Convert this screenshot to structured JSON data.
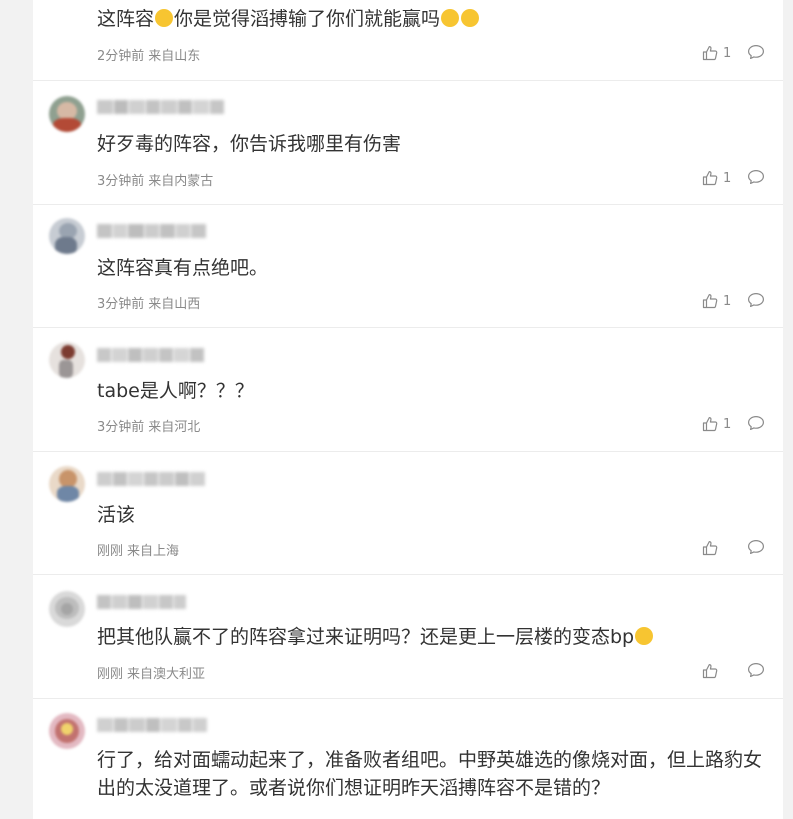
{
  "comments": [
    {
      "text": "这阵容",
      "text_after": "你是觉得滔搏输了你们就能赢吗",
      "time": "2分钟前",
      "location": "来自山东",
      "likes": "1"
    },
    {
      "text": "好歹毒的阵容，你告诉我哪里有伤害",
      "time": "3分钟前",
      "location": "来自内蒙古",
      "likes": "1"
    },
    {
      "text": "这阵容真有点绝吧。",
      "time": "3分钟前",
      "location": "来自山西",
      "likes": "1"
    },
    {
      "text": "tabe是人啊？？？",
      "time": "3分钟前",
      "location": "来自河北",
      "likes": "1"
    },
    {
      "text": "活该",
      "time": "刚刚",
      "location": "来自上海",
      "likes": ""
    },
    {
      "text": "把其他队赢不了的阵容拿过来证明吗？还是更上一层楼的变态bp",
      "time": "刚刚",
      "location": "来自澳大利亚",
      "likes": ""
    },
    {
      "text": "行了，给对面蠕动起来了，准备败者组吧。中野英雄选的像烧对面，但上路豹女出的太没道理了。或者说你们想证明昨天滔搏阵容不是错的？"
    }
  ],
  "icons": {
    "like": "thumbs-up-icon",
    "reply": "comment-bubble-icon",
    "emoji_smile": "smile-emoji-icon",
    "emoji_woozy": "woozy-emoji-icon"
  },
  "colors": {
    "background": "#f2f2f2",
    "panel": "#ffffff",
    "text": "#333333",
    "meta": "#8a8a8a",
    "separator": "#ececec",
    "emoji": "#f7c531"
  }
}
